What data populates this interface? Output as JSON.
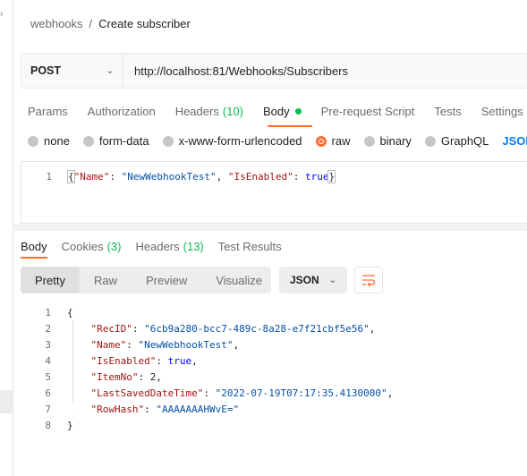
{
  "breadcrumb": {
    "parent": "webhooks",
    "separator": "/",
    "current": "Create subscriber"
  },
  "request": {
    "method": "POST",
    "url": "http://localhost:81/Webhooks/Subscribers",
    "tabs": [
      {
        "label": "Params"
      },
      {
        "label": "Authorization"
      },
      {
        "label": "Headers",
        "count": "(10)"
      },
      {
        "label": "Body"
      },
      {
        "label": "Pre-request Script"
      },
      {
        "label": "Tests"
      },
      {
        "label": "Settings"
      }
    ],
    "body_types": [
      "none",
      "form-data",
      "x-www-form-urlencoded",
      "raw",
      "binary",
      "GraphQL"
    ],
    "selected_body_type": "raw",
    "raw_format": "JSON",
    "editor": {
      "line_number": "1",
      "open": "{",
      "key1": "\"Name\"",
      "sep1": ": ",
      "val1": "\"NewWebhookTest\"",
      "comma1": ", ",
      "key2": "\"IsEnabled\"",
      "sep2": ": ",
      "val2": "true",
      "close": "}"
    }
  },
  "response": {
    "tabs": [
      {
        "label": "Body"
      },
      {
        "label": "Cookies",
        "count": "(3)"
      },
      {
        "label": "Headers",
        "count": "(13)"
      },
      {
        "label": "Test Results"
      }
    ],
    "views": [
      "Pretty",
      "Raw",
      "Preview",
      "Visualize"
    ],
    "format": "JSON",
    "lines": [
      {
        "num": "1",
        "text": "{"
      },
      {
        "num": "2",
        "key": "\"RecID\"",
        "value": "\"6cb9a280-bcc7-489c-8a28-e7f21cbf5e56\"",
        "tail": ","
      },
      {
        "num": "3",
        "key": "\"Name\"",
        "value": "\"NewWebhookTest\"",
        "tail": ","
      },
      {
        "num": "4",
        "key": "\"IsEnabled\"",
        "value": "true",
        "tail": ","
      },
      {
        "num": "5",
        "key": "\"ItemNo\"",
        "value": "2",
        "tail": ","
      },
      {
        "num": "6",
        "key": "\"LastSavedDateTime\"",
        "value": "\"2022-07-19T07:17:35.4130000\"",
        "tail": ","
      },
      {
        "num": "7",
        "key": "\"RowHash\"",
        "value": "\"AAAAAAAHWvE=\"",
        "tail": ""
      },
      {
        "num": "8",
        "text": "}"
      }
    ]
  },
  "colors": {
    "accent": "#ff6c37",
    "success": "#0cbb52",
    "link": "#097bed"
  }
}
